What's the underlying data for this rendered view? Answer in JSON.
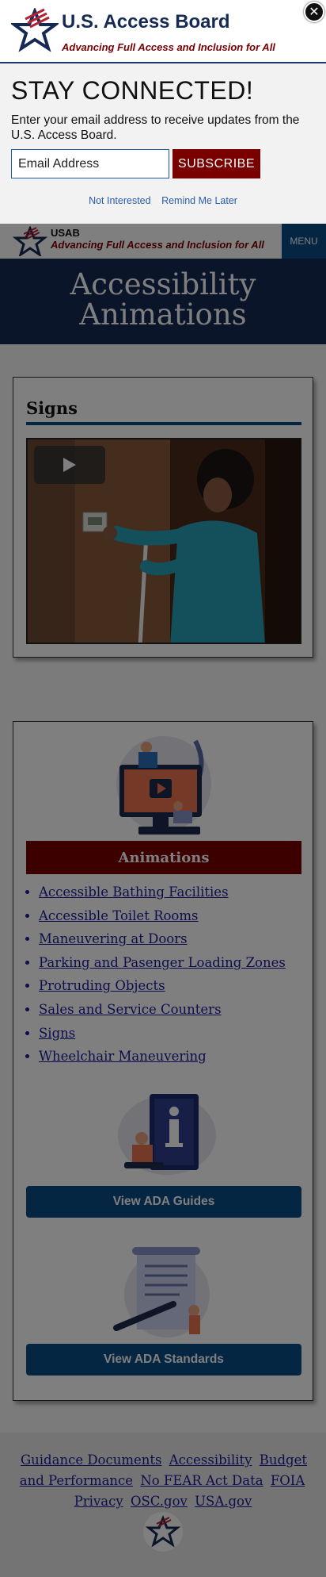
{
  "header": {
    "logo_text": "USAB",
    "tagline": "Advancing Full Access and Inclusion for All",
    "menu_label": "MENU"
  },
  "hero": {
    "title_line1": "Accessibility",
    "title_line2": "Animations"
  },
  "signs_card": {
    "title": "Signs"
  },
  "animations_card": {
    "band_label": "Animations",
    "links": [
      "Accessible Bathing Facilities",
      "Accessible Toilet Rooms",
      "Maneuvering at Doors",
      "Parking and Pasenger Loading Zones",
      "Protruding Objects",
      "Sales and Service Counters",
      "Signs",
      "Wheelchair Maneuvering"
    ],
    "guides_button": "View ADA Guides",
    "standards_button": "View ADA Standards"
  },
  "footer": {
    "links": [
      "Guidance Documents",
      "Accessibility",
      "Budget and Performance",
      "No FEAR Act Data",
      "FOIA",
      "Privacy",
      "OSC.gov",
      "USA.gov"
    ]
  },
  "modal": {
    "brand": "U.S. Access Board",
    "tagline": "Advancing Full Access and Inclusion for All",
    "heading": "STAY CONNECTED!",
    "description": "Enter your email address to receive updates from the U.S. Access Board.",
    "email_placeholder": "Email Address",
    "subscribe_label": "SUBSCRIBE",
    "not_interested": "Not Interested",
    "remind_later": "Remind Me Later",
    "close_glyph": "✕"
  },
  "colors": {
    "navy": "#142a55",
    "brand_red": "#7a0000",
    "button_blue": "#0b4d87",
    "link_blue": "#1a1a9a"
  }
}
